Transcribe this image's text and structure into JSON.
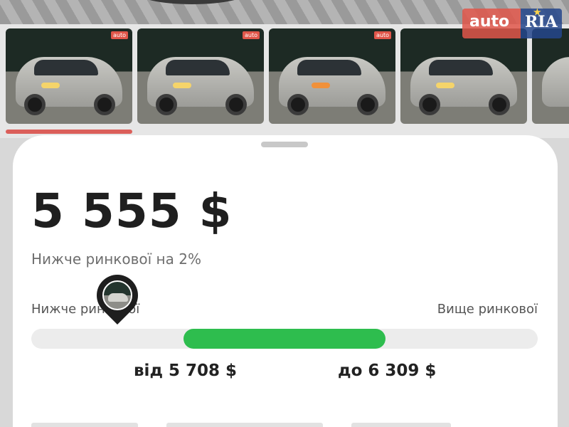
{
  "watermark": {
    "auto": "auto",
    "ria": "RIA"
  },
  "gallery": {
    "thumbnail_tag": "auto",
    "thumbnails": 5,
    "active_index": 0
  },
  "price": {
    "value": "5 555 $",
    "note": "Нижче ринкової на 2%"
  },
  "market_scale": {
    "left_label": "Нижче ринкової",
    "right_label": "Вище ринкової",
    "marker_position": 0.17,
    "range_start": 0.3,
    "range_end": 0.7,
    "range_from": "від 5 708 $",
    "range_to": "до 6 309 $",
    "range_color": "#2ebd4e",
    "track_color": "#ececec"
  },
  "colors": {
    "accent_red": "#db5f5a",
    "price_text": "#1f1f1f"
  }
}
